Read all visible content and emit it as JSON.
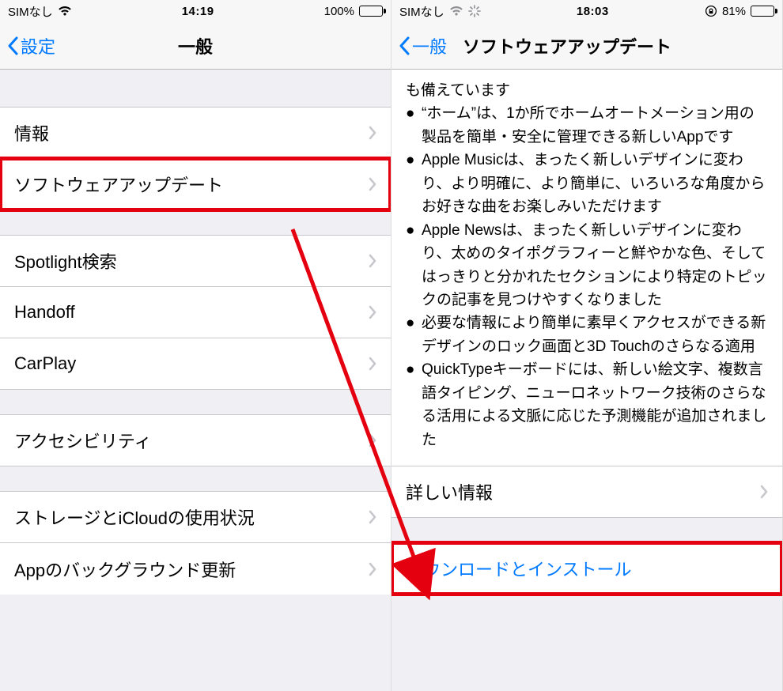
{
  "left": {
    "status": {
      "carrier": "SIMなし",
      "time": "14:19",
      "battery_pct": "100%"
    },
    "nav": {
      "back_label": "設定",
      "title": "一般"
    },
    "rows": {
      "info": "情報",
      "software_update": "ソフトウェアアップデート",
      "spotlight": "Spotlight検索",
      "handoff": "Handoff",
      "carplay": "CarPlay",
      "accessibility": "アクセシビリティ",
      "storage": "ストレージとiCloudの使用状況",
      "bg_refresh": "Appのバックグラウンド更新"
    }
  },
  "right": {
    "status": {
      "carrier": "SIMなし",
      "time": "18:03",
      "battery_pct": "81%"
    },
    "nav": {
      "back_label": "一般",
      "title": "ソフトウェアアップデート"
    },
    "notes": {
      "line0": "も備えています",
      "b1": "“ホーム”は、1か所でホームオートメーション用の製品を簡単・安全に管理できる新しいAppです",
      "b2": "Apple Musicは、まったく新しいデザインに変わり、より明確に、より簡単に、いろいろな角度からお好きな曲をお楽しみいただけます",
      "b3": "Apple Newsは、まったく新しいデザインに変わり、太めのタイポグラフィーと鮮やかな色、そしてはっきりと分かれたセクションにより特定のトピックの記事を見つけやすくなりました",
      "b4": "必要な情報により簡単に素早くアクセスができる新デザインのロック画面と3D Touchのさらなる適用",
      "b5": "QuickTypeキーボードには、新しい絵文字、複数言語タイピング、ニューロネットワーク技術のさらなる活用による文脈に応じた予測機能が追加されました"
    },
    "rows": {
      "more_info": "詳しい情報",
      "download_install": "ダウンロードとインストール"
    }
  }
}
